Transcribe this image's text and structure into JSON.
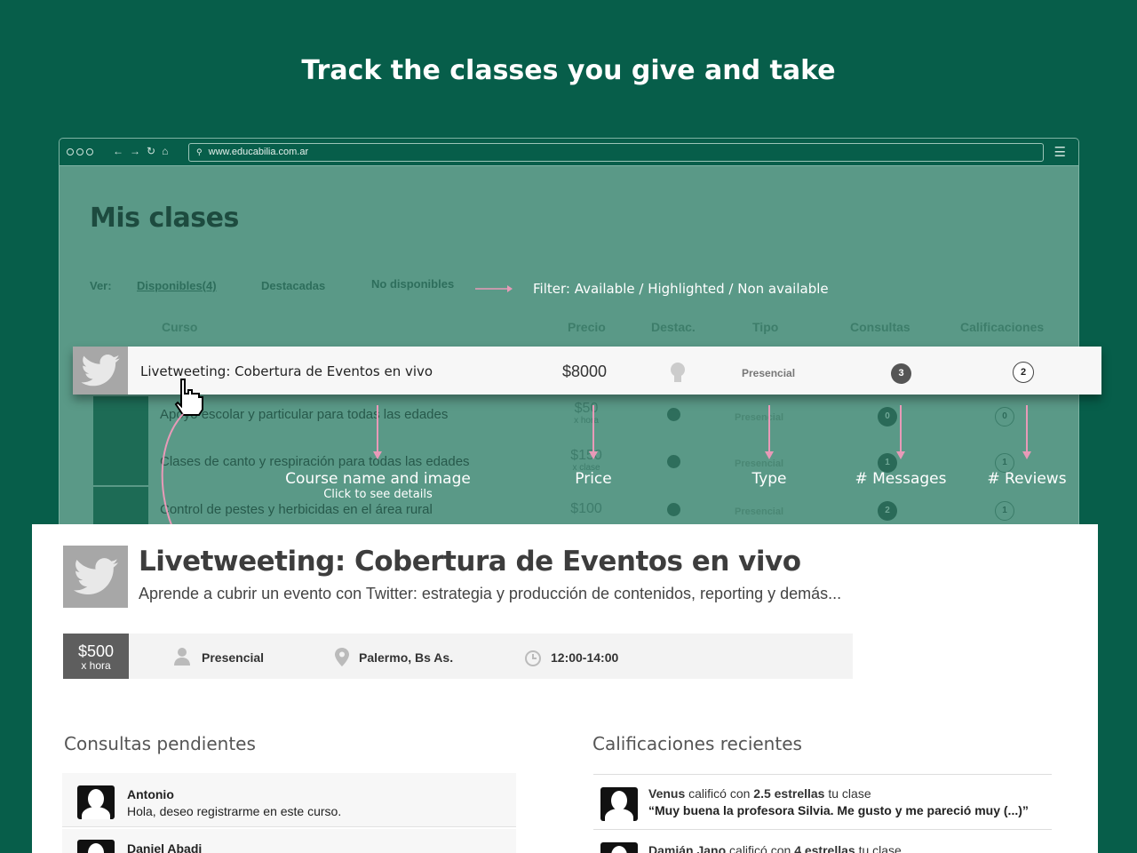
{
  "headline": "Track the classes you give and take",
  "browser": {
    "url": "www.educabilia.com.ar"
  },
  "page": {
    "title": "Mis clases",
    "filter_label": "Ver:",
    "filters": [
      "Disponibles(4)",
      "Destacadas",
      "No disponibles"
    ],
    "filter_note": "Filter: Available / Highlighted / Non available",
    "columns": [
      "Curso",
      "Precio",
      "Destac.",
      "Tipo",
      "Consultas",
      "Calificaciones"
    ]
  },
  "highlight_row": {
    "name": "Livetweeting: Cobertura de Eventos en vivo",
    "price": "$8000",
    "type": "Presencial",
    "messages": "3",
    "reviews": "2"
  },
  "rows": [
    {
      "name": "Apoyo escolar y particular para todas las edades",
      "price": "$50",
      "unit": "x hora",
      "type": "Presencial",
      "messages": "0",
      "reviews": "0"
    },
    {
      "name": "Clases de canto y respiración para todas las edades",
      "price": "$150",
      "unit": "x clase",
      "type": "Presencial",
      "messages": "1",
      "reviews": "1"
    },
    {
      "name": "Control de pestes y herbicidas en el área rural",
      "price": "$100",
      "unit": "",
      "type": "Presencial",
      "messages": "2",
      "reviews": "1"
    }
  ],
  "callouts": {
    "course": "Course name and image",
    "course_sub": "Click to see details",
    "price": "Price",
    "type": "Type",
    "messages": "# Messages",
    "reviews": "# Reviews"
  },
  "detail": {
    "title": "Livetweeting: Cobertura de Eventos en vivo",
    "subtitle": "Aprende a cubrir un evento con Twitter: estrategia y producción de contenidos, reporting y demás...",
    "price": "$500",
    "price_unit": "x hora",
    "type": "Presencial",
    "location": "Palermo, Bs As.",
    "time": "12:00-14:00",
    "pending_heading": "Consultas pendientes",
    "reviews_heading": "Calificaciones recientes",
    "messages": [
      {
        "name": "Antonio",
        "text": "Hola, deseo registrarme en este curso."
      },
      {
        "name": "Daniel Abadi",
        "text": ""
      }
    ],
    "reviews": [
      {
        "user": "Venus",
        "mid": " calificó con ",
        "rating": "2.5 estrellas",
        "end": " tu clase",
        "quote": "“Muy buena la profesora Silvia. Me gusto y me pareció muy (...)”"
      },
      {
        "user": "Damián Jano",
        "mid": " calificó con ",
        "rating": "4 estrellas",
        "end": " tu clase",
        "quote": ""
      }
    ]
  },
  "colors": {
    "background": "#075e4a",
    "overlay": "#5a9987",
    "accent_arrow": "#e89ab8"
  }
}
